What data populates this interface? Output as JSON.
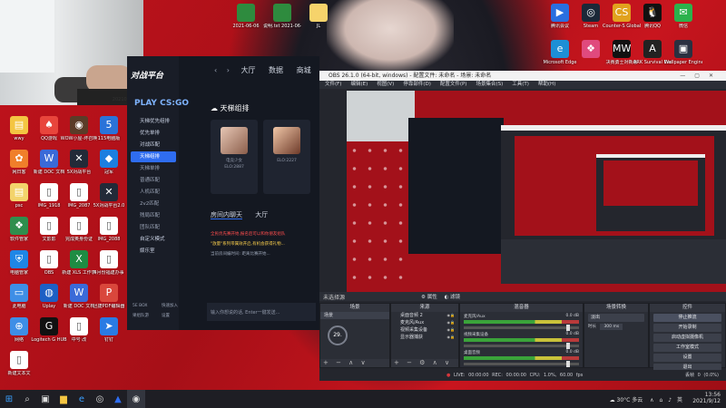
{
  "desktop": {
    "left_icons": [
      {
        "label": "wwy",
        "color": "#f4c542",
        "glyph": "▤"
      },
      {
        "label": "QQ游戏",
        "color": "#e8453c",
        "glyph": "♠"
      },
      {
        "label": "WOW小屋-坏召唤",
        "color": "#5a3c28",
        "glyph": "◉"
      },
      {
        "label": "115电脑版",
        "color": "#2a73d9",
        "glyph": "5"
      },
      {
        "label": "网日客",
        "color": "#f07f2a",
        "glyph": "✿"
      },
      {
        "label": "新建 DOC 文档",
        "color": "#3a6ad8",
        "glyph": "W"
      },
      {
        "label": "5X对战平台",
        "color": "#222a38",
        "glyph": "✕"
      },
      {
        "label": "冠军",
        "color": "#1c7fe0",
        "glyph": "◆"
      },
      {
        "label": "psc",
        "color": "#f3d36b",
        "glyph": "▤"
      },
      {
        "label": "IMG_1918",
        "color": "#ffffff",
        "glyph": "▯"
      },
      {
        "label": "IMG_2087",
        "color": "#ffffff",
        "glyph": "▯"
      },
      {
        "label": "5X对战平台2.0",
        "color": "#222a38",
        "glyph": "✕"
      },
      {
        "label": "软件管家",
        "color": "#2f8e4d",
        "glyph": "❖"
      },
      {
        "label": "文影影",
        "color": "#ffffff",
        "glyph": "▯"
      },
      {
        "label": "完成奥身份证",
        "color": "#ffffff",
        "glyph": "▯"
      },
      {
        "label": "IMG_2088",
        "color": "#ffffff",
        "glyph": "▯"
      },
      {
        "label": "电脑管家",
        "color": "#1f86e6",
        "glyph": "⛨"
      },
      {
        "label": "OBS",
        "color": "#ffffff",
        "glyph": "▯"
      },
      {
        "label": "新建 XLS 工作表",
        "color": "#1e8c43",
        "glyph": "X"
      },
      {
        "label": "4月份福建办事",
        "color": "#ffffff",
        "glyph": "▯"
      },
      {
        "label": "此电脑",
        "color": "#3e8ee6",
        "glyph": "▭"
      },
      {
        "label": "Uplay",
        "color": "#1d5fc4",
        "glyph": "◍"
      },
      {
        "label": "新建 DOC 文档",
        "color": "#3a6ad8",
        "glyph": "W"
      },
      {
        "label": "迅捷PDF编辑器",
        "color": "#d9473c",
        "glyph": "P"
      },
      {
        "label": "网络",
        "color": "#3e8ee6",
        "glyph": "⊕"
      },
      {
        "label": "Logitech G HUB",
        "color": "#111111",
        "glyph": "G"
      },
      {
        "label": "中号 改",
        "color": "#ffffff",
        "glyph": "▯"
      },
      {
        "label": "钉钉",
        "color": "#2a7be4",
        "glyph": "➤"
      },
      {
        "label": "新建文本文",
        "color": "#ffffff",
        "glyph": "▯"
      }
    ],
    "right_icons": [
      {
        "label": "腾讯会议",
        "color": "#2a6fe0",
        "glyph": "▶"
      },
      {
        "label": "Steam",
        "color": "#1b2838",
        "glyph": "◎"
      },
      {
        "label": "Counter-S Global Off...",
        "color": "#e1a21e",
        "glyph": "CS"
      },
      {
        "label": "腾讯QQ",
        "color": "#111111",
        "glyph": "🐧"
      },
      {
        "label": "微信",
        "color": "#2bb24c",
        "glyph": "✉"
      },
      {
        "label": "Microsoft Edge",
        "color": "#1d8fd6",
        "glyph": "e"
      },
      {
        "label": "",
        "color": "#e04a7d",
        "glyph": "❖"
      },
      {
        "label": "决赛勇士对新版",
        "color": "#111111",
        "glyph": "MW"
      },
      {
        "label": "ARK Survival Evolved",
        "color": "#222222",
        "glyph": "A"
      },
      {
        "label": "Wallpaper Engine",
        "color": "#2a3040",
        "glyph": "▣"
      }
    ],
    "top_files": [
      {
        "label": "2021-06-06",
        "color": "#2e8b3e"
      },
      {
        "label": "说明.txt 2021-06-06",
        "color": "#2e8b3e"
      },
      {
        "label": "JL",
        "color": "#f6d36b"
      }
    ]
  },
  "webcam": {
    "stamp": "20210127..."
  },
  "platform": {
    "logo": "对战平台",
    "game": "PLAY CS:GO",
    "top_tabs": [
      "大厅",
      "数据",
      "商城"
    ],
    "nav": [
      {
        "label": "天梯优先组排",
        "type": "hdr"
      },
      {
        "label": "优先单排",
        "type": "hdr"
      },
      {
        "label": "对战匹配",
        "type": "hdr"
      },
      {
        "label": "天梯组排",
        "type": "active"
      },
      {
        "label": "天梯单排",
        "type": ""
      },
      {
        "label": "普通匹配",
        "type": ""
      },
      {
        "label": "人机匹配",
        "type": ""
      },
      {
        "label": "2v2匹配",
        "type": ""
      },
      {
        "label": "残局匹配",
        "type": ""
      },
      {
        "label": "团队匹配",
        "type": ""
      },
      {
        "label": "自定义模式",
        "type": "hdr"
      },
      {
        "label": "娱乐室",
        "type": "hdr"
      }
    ],
    "bottom_links": [
      "5E BOX",
      "快速加入",
      "果组队游",
      "设置"
    ],
    "section_title": "天梯组排",
    "players": [
      {
        "name": "电竞少女",
        "elo": "ELO:2887"
      },
      {
        "name": "",
        "elo": "ELO:2227"
      }
    ],
    "chat_tabs": [
      "房间内聊天",
      "大厅"
    ],
    "messages": [
      {
        "text": "全民优先赛开始,报名后可以和你朋友组队",
        "color": "#ff4d4d"
      },
      {
        "text": "\"放量\"系列带属效开启,有机会获得礼物...",
        "color": "#ffd24d"
      },
      {
        "text": "当前房间编时间: 距离比赛开始...",
        "color": "#9aa3b5"
      }
    ],
    "chat_placeholder": "输入你想说的话, Enter一键发送..."
  },
  "obs": {
    "title": "OBS 26.1.0 (64-bit, windows) - 配置文件: 未命名 - 场景: 未命名",
    "menu": [
      "文件(F)",
      "编辑(E)",
      "视图(V)",
      "停靠部件(D)",
      "配置文件(P)",
      "场景集合(S)",
      "工具(T)",
      "帮助(H)"
    ],
    "preview_label": "未选择源",
    "mid_controls": [
      "属性",
      "滤镜"
    ],
    "panels": {
      "scenes": "场景",
      "sources": "来源",
      "mixer": "混音器",
      "transitions": "场景转换",
      "controls": "控件"
    },
    "scene_item": "场景",
    "timer": "29.",
    "sources": [
      "桌面音频 2",
      "麦克风/Aux",
      "视频采集设备",
      "显示器捕获"
    ],
    "mixer": [
      {
        "name": "麦克风/Aux",
        "db": "0.0 dB"
      },
      {
        "name": "视频采集设备",
        "db": "0.0 dB"
      },
      {
        "name": "桌面音频",
        "db": "0.0 dB"
      }
    ],
    "transition": {
      "name": "淡出",
      "duration_label": "时长",
      "duration": "300 ms"
    },
    "controls": [
      "停止推流",
      "开始录制",
      "启动虚拟摄像机",
      "工作室模式",
      "设置",
      "退出"
    ],
    "status": "LIVE: 00:00:00  REC: 00:00:00  CPU: 1.0%, 60.00 fps",
    "live_status": "丢帧 0 (0.0%)"
  },
  "taskbar": {
    "weather": "30°C 多云",
    "ime": "英",
    "time": "13:56",
    "date": "2021/9/12"
  }
}
